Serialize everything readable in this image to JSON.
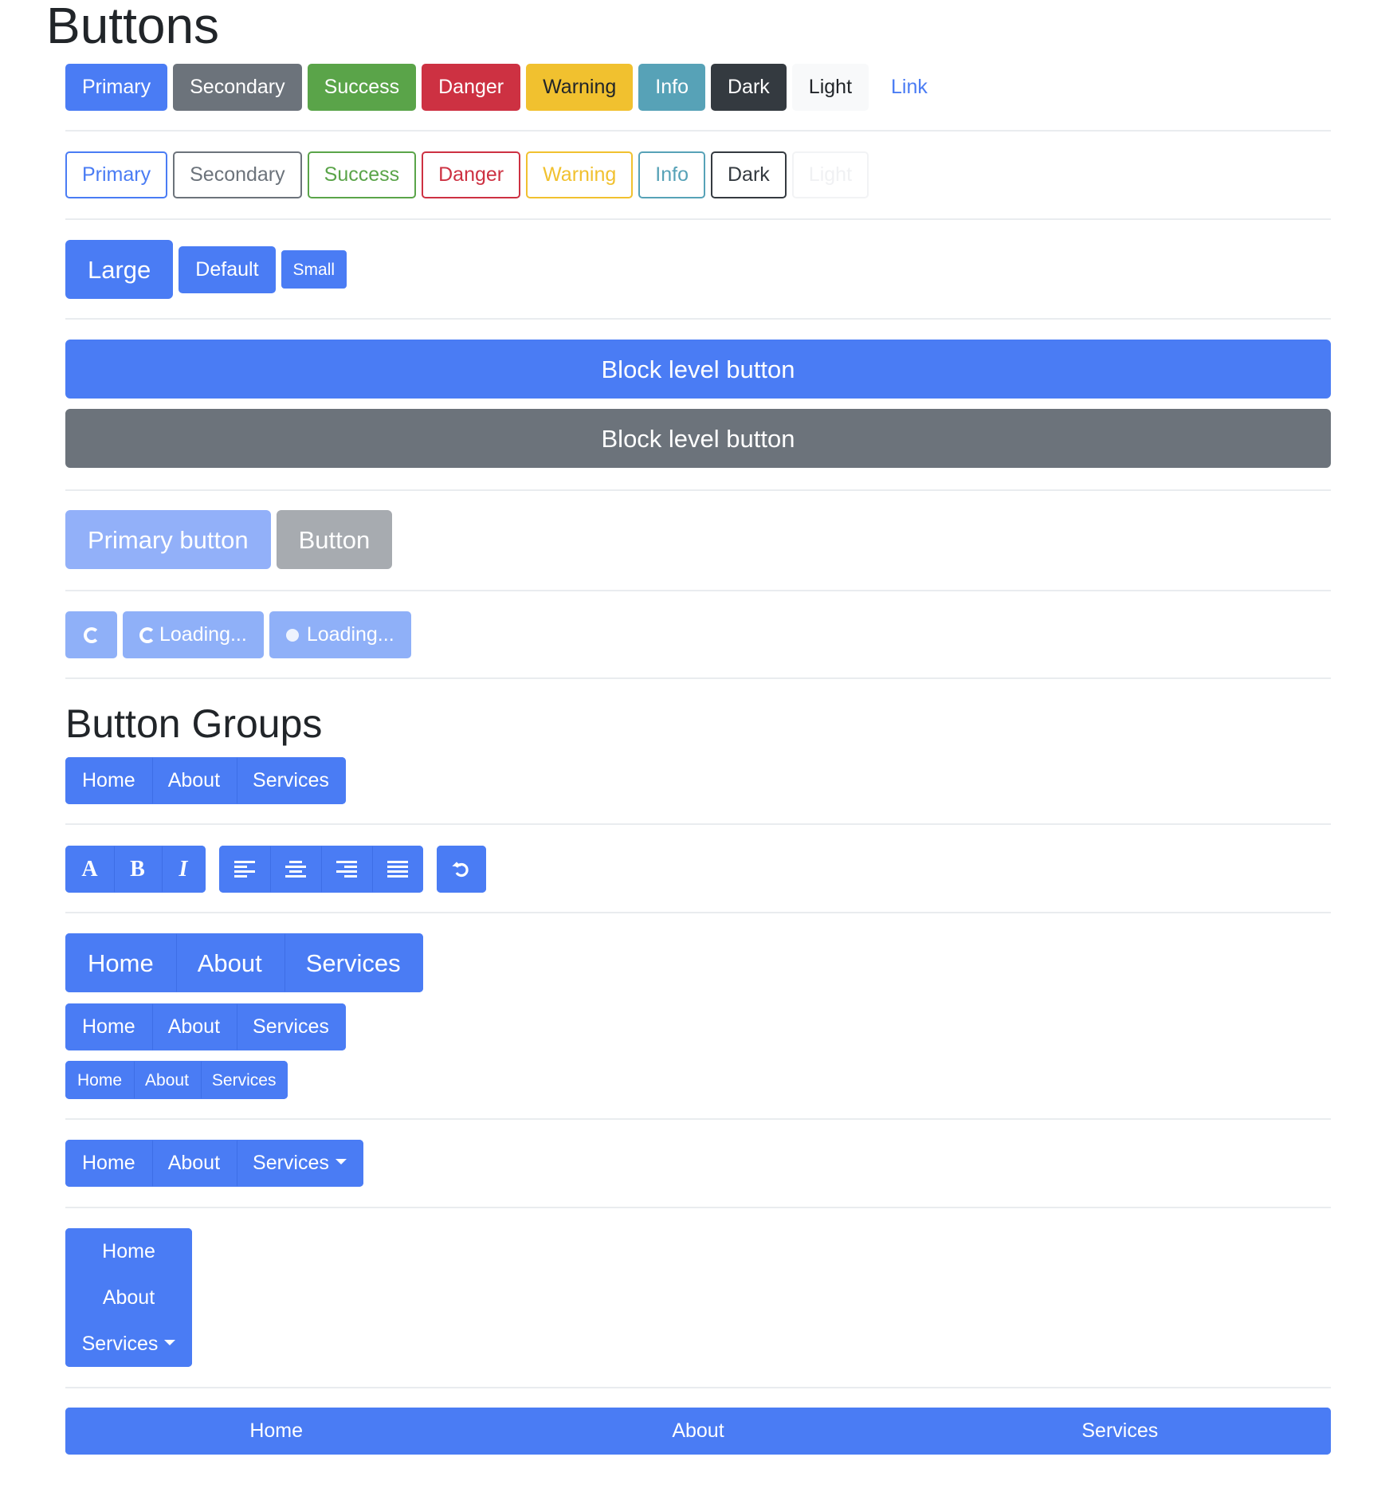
{
  "page_title": "Buttons",
  "solid_buttons": [
    "Primary",
    "Secondary",
    "Success",
    "Danger",
    "Warning",
    "Info",
    "Dark",
    "Light",
    "Link"
  ],
  "outline_buttons": [
    "Primary",
    "Secondary",
    "Success",
    "Danger",
    "Warning",
    "Info",
    "Dark",
    "Light"
  ],
  "sizes": {
    "large": "Large",
    "default": "Default",
    "small": "Small"
  },
  "block_buttons": [
    "Block level button",
    "Block level button"
  ],
  "disabled_buttons": {
    "primary": "Primary button",
    "secondary": "Button"
  },
  "loading": {
    "border_label": "Loading...",
    "grow_label": "Loading..."
  },
  "groups_title": "Button Groups",
  "nav_group": [
    "Home",
    "About",
    "Services"
  ],
  "text_format_group": [
    "A",
    "B",
    "I"
  ],
  "toolbar_icons": [
    "align-left-icon",
    "align-center-icon",
    "align-right-icon",
    "align-justify-icon",
    "undo-icon"
  ],
  "sized_groups": {
    "large": [
      "Home",
      "About",
      "Services"
    ],
    "default": [
      "Home",
      "About",
      "Services"
    ],
    "small": [
      "Home",
      "About",
      "Services"
    ]
  },
  "dropdown_group": {
    "items": [
      "Home",
      "About"
    ],
    "dropdown_label": "Services"
  },
  "vertical_group": {
    "items": [
      "Home",
      "About"
    ],
    "dropdown_label": "Services"
  },
  "justified_group": [
    "Home",
    "About",
    "Services"
  ],
  "colors": {
    "primary": "#4a7cf4",
    "secondary": "#6c737b",
    "success": "#5aa449",
    "danger": "#cd3142",
    "warning": "#f1c12f",
    "info": "#57a2b7",
    "dark": "#343a40",
    "light": "#f8f9fa"
  }
}
